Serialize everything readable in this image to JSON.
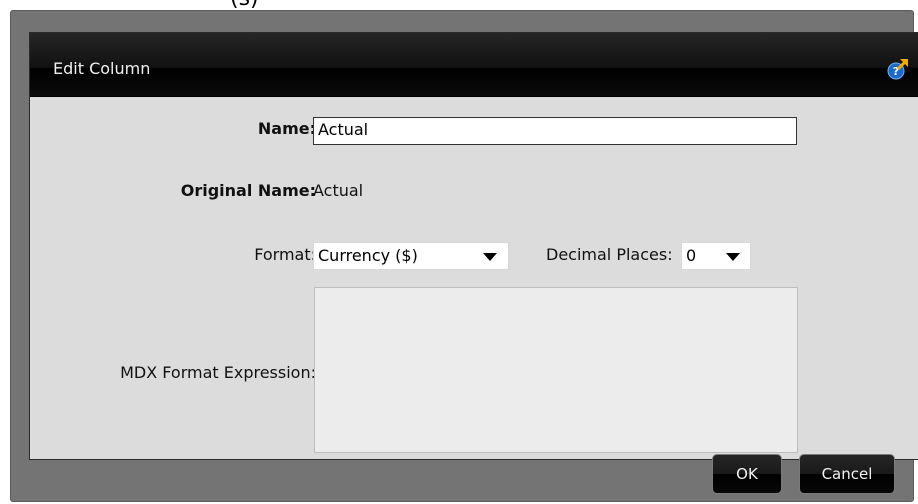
{
  "backdrop": {
    "partial_text": "(s)"
  },
  "dialog": {
    "title": "Edit Column",
    "help_icon": "help-question-icon"
  },
  "form": {
    "name_label": "Name:",
    "name_value": "Actual",
    "original_name_label": "Original Name:",
    "original_name_value": "Actual",
    "format_label": "Format:",
    "format_value": "Currency ($)",
    "decimal_places_label": "Decimal Places:",
    "decimal_places_value": "0",
    "mdx_label": "MDX Format Expression:",
    "mdx_value": ""
  },
  "buttons": {
    "ok": "OK",
    "cancel": "Cancel"
  },
  "colors": {
    "title_bar": "#000000",
    "dialog_body": "#dcdcdc",
    "dialog_frame": "#747474"
  }
}
